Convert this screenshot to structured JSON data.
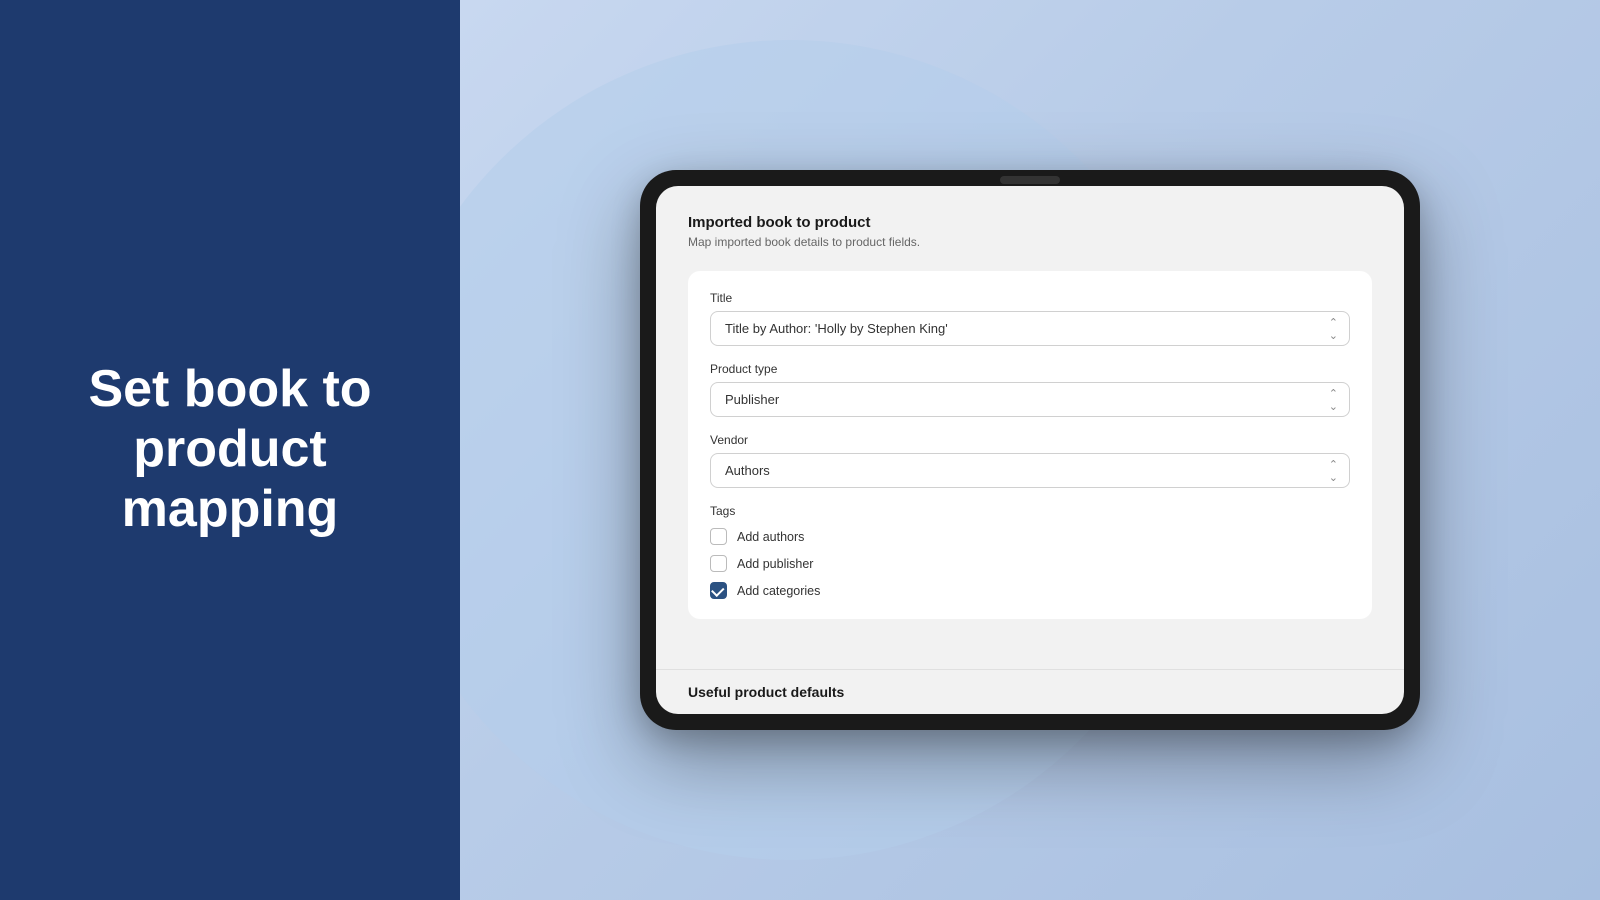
{
  "left": {
    "heading_line1": "Set book to",
    "heading_line2": "product",
    "heading_line3": "mapping"
  },
  "tablet": {
    "form": {
      "title": "Imported book to product",
      "subtitle": "Map imported book details to product fields.",
      "fields": {
        "title_label": "Title",
        "title_value": "Title by Author: 'Holly by Stephen King'",
        "product_type_label": "Product type",
        "product_type_value": "Publisher",
        "vendor_label": "Vendor",
        "vendor_value": "Authors"
      },
      "tags": {
        "label": "Tags",
        "checkboxes": [
          {
            "id": "add-authors",
            "label": "Add authors",
            "checked": false
          },
          {
            "id": "add-publisher",
            "label": "Add publisher",
            "checked": false
          },
          {
            "id": "add-categories",
            "label": "Add categories",
            "checked": true
          }
        ]
      }
    },
    "bottom": {
      "title": "Useful product defaults"
    }
  }
}
